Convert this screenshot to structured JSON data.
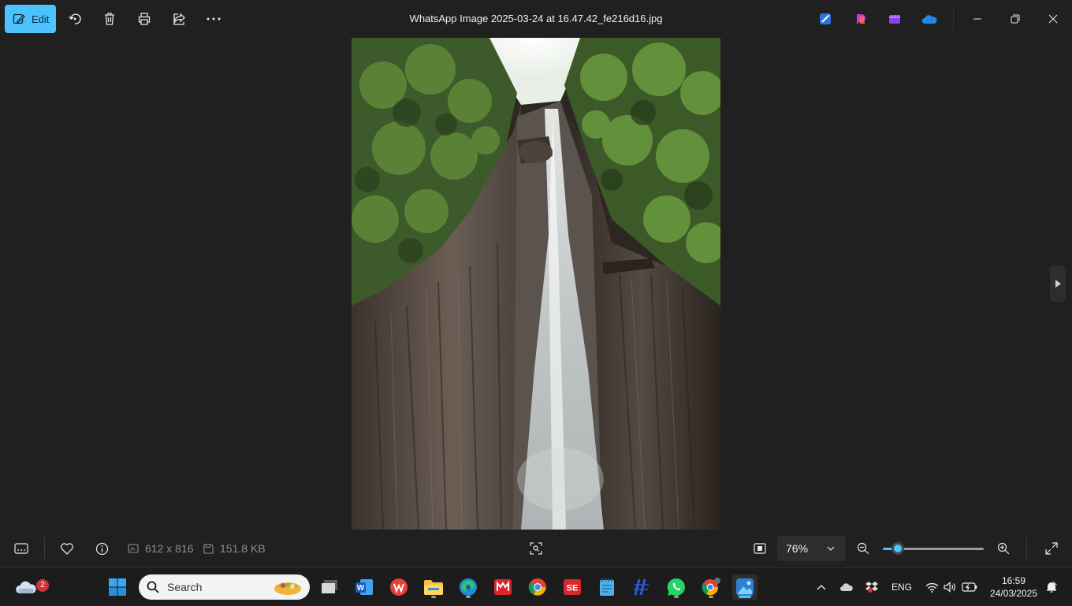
{
  "toolbar": {
    "edit_label": "Edit",
    "icons": [
      "rotate-icon",
      "delete-icon",
      "print-icon",
      "share-icon",
      "more-icon"
    ]
  },
  "window": {
    "title": "WhatsApp Image 2025-03-24 at 16.47.42_fe216d16.jpg"
  },
  "info": {
    "dimensions": "612 x 816",
    "file_size": "151.8 KB"
  },
  "zoom": {
    "level_label": "76%",
    "slider_fraction": 0.15
  },
  "taskbar": {
    "search_placeholder": "Search",
    "weather_badge": "2",
    "language": "ENG",
    "time": "16:59",
    "date": "24/03/2025"
  },
  "colors": {
    "accent": "#4cc2ff",
    "background": "#202020"
  }
}
